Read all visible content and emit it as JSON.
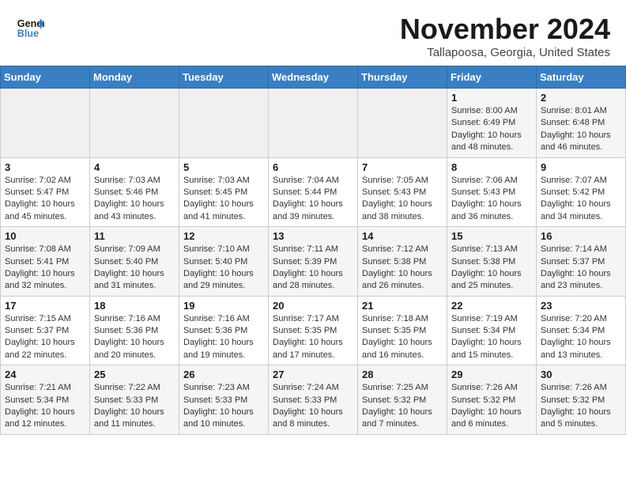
{
  "header": {
    "logo_line1": "General",
    "logo_line2": "Blue",
    "month": "November 2024",
    "location": "Tallapoosa, Georgia, United States"
  },
  "weekdays": [
    "Sunday",
    "Monday",
    "Tuesday",
    "Wednesday",
    "Thursday",
    "Friday",
    "Saturday"
  ],
  "weeks": [
    [
      {
        "day": "",
        "detail": ""
      },
      {
        "day": "",
        "detail": ""
      },
      {
        "day": "",
        "detail": ""
      },
      {
        "day": "",
        "detail": ""
      },
      {
        "day": "",
        "detail": ""
      },
      {
        "day": "1",
        "detail": "Sunrise: 8:00 AM\nSunset: 6:49 PM\nDaylight: 10 hours\nand 48 minutes."
      },
      {
        "day": "2",
        "detail": "Sunrise: 8:01 AM\nSunset: 6:48 PM\nDaylight: 10 hours\nand 46 minutes."
      }
    ],
    [
      {
        "day": "3",
        "detail": "Sunrise: 7:02 AM\nSunset: 5:47 PM\nDaylight: 10 hours\nand 45 minutes."
      },
      {
        "day": "4",
        "detail": "Sunrise: 7:03 AM\nSunset: 5:46 PM\nDaylight: 10 hours\nand 43 minutes."
      },
      {
        "day": "5",
        "detail": "Sunrise: 7:03 AM\nSunset: 5:45 PM\nDaylight: 10 hours\nand 41 minutes."
      },
      {
        "day": "6",
        "detail": "Sunrise: 7:04 AM\nSunset: 5:44 PM\nDaylight: 10 hours\nand 39 minutes."
      },
      {
        "day": "7",
        "detail": "Sunrise: 7:05 AM\nSunset: 5:43 PM\nDaylight: 10 hours\nand 38 minutes."
      },
      {
        "day": "8",
        "detail": "Sunrise: 7:06 AM\nSunset: 5:43 PM\nDaylight: 10 hours\nand 36 minutes."
      },
      {
        "day": "9",
        "detail": "Sunrise: 7:07 AM\nSunset: 5:42 PM\nDaylight: 10 hours\nand 34 minutes."
      }
    ],
    [
      {
        "day": "10",
        "detail": "Sunrise: 7:08 AM\nSunset: 5:41 PM\nDaylight: 10 hours\nand 32 minutes."
      },
      {
        "day": "11",
        "detail": "Sunrise: 7:09 AM\nSunset: 5:40 PM\nDaylight: 10 hours\nand 31 minutes."
      },
      {
        "day": "12",
        "detail": "Sunrise: 7:10 AM\nSunset: 5:40 PM\nDaylight: 10 hours\nand 29 minutes."
      },
      {
        "day": "13",
        "detail": "Sunrise: 7:11 AM\nSunset: 5:39 PM\nDaylight: 10 hours\nand 28 minutes."
      },
      {
        "day": "14",
        "detail": "Sunrise: 7:12 AM\nSunset: 5:38 PM\nDaylight: 10 hours\nand 26 minutes."
      },
      {
        "day": "15",
        "detail": "Sunrise: 7:13 AM\nSunset: 5:38 PM\nDaylight: 10 hours\nand 25 minutes."
      },
      {
        "day": "16",
        "detail": "Sunrise: 7:14 AM\nSunset: 5:37 PM\nDaylight: 10 hours\nand 23 minutes."
      }
    ],
    [
      {
        "day": "17",
        "detail": "Sunrise: 7:15 AM\nSunset: 5:37 PM\nDaylight: 10 hours\nand 22 minutes."
      },
      {
        "day": "18",
        "detail": "Sunrise: 7:16 AM\nSunset: 5:36 PM\nDaylight: 10 hours\nand 20 minutes."
      },
      {
        "day": "19",
        "detail": "Sunrise: 7:16 AM\nSunset: 5:36 PM\nDaylight: 10 hours\nand 19 minutes."
      },
      {
        "day": "20",
        "detail": "Sunrise: 7:17 AM\nSunset: 5:35 PM\nDaylight: 10 hours\nand 17 minutes."
      },
      {
        "day": "21",
        "detail": "Sunrise: 7:18 AM\nSunset: 5:35 PM\nDaylight: 10 hours\nand 16 minutes."
      },
      {
        "day": "22",
        "detail": "Sunrise: 7:19 AM\nSunset: 5:34 PM\nDaylight: 10 hours\nand 15 minutes."
      },
      {
        "day": "23",
        "detail": "Sunrise: 7:20 AM\nSunset: 5:34 PM\nDaylight: 10 hours\nand 13 minutes."
      }
    ],
    [
      {
        "day": "24",
        "detail": "Sunrise: 7:21 AM\nSunset: 5:34 PM\nDaylight: 10 hours\nand 12 minutes."
      },
      {
        "day": "25",
        "detail": "Sunrise: 7:22 AM\nSunset: 5:33 PM\nDaylight: 10 hours\nand 11 minutes."
      },
      {
        "day": "26",
        "detail": "Sunrise: 7:23 AM\nSunset: 5:33 PM\nDaylight: 10 hours\nand 10 minutes."
      },
      {
        "day": "27",
        "detail": "Sunrise: 7:24 AM\nSunset: 5:33 PM\nDaylight: 10 hours\nand 8 minutes."
      },
      {
        "day": "28",
        "detail": "Sunrise: 7:25 AM\nSunset: 5:32 PM\nDaylight: 10 hours\nand 7 minutes."
      },
      {
        "day": "29",
        "detail": "Sunrise: 7:26 AM\nSunset: 5:32 PM\nDaylight: 10 hours\nand 6 minutes."
      },
      {
        "day": "30",
        "detail": "Sunrise: 7:26 AM\nSunset: 5:32 PM\nDaylight: 10 hours\nand 5 minutes."
      }
    ]
  ]
}
